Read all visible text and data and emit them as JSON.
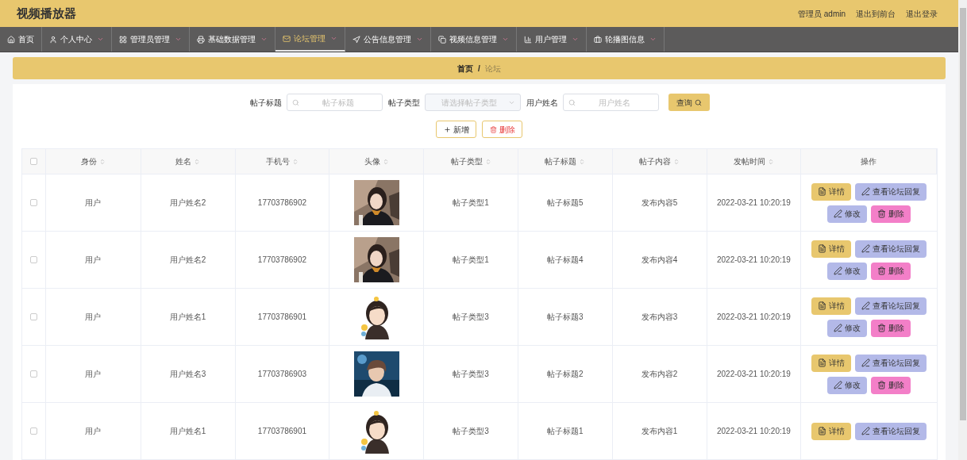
{
  "header": {
    "title": "视频播放器",
    "user": "管理员 admin",
    "links": [
      "退出到前台",
      "退出登录"
    ]
  },
  "nav": [
    {
      "label": "首页",
      "selected": false,
      "dropdown": false
    },
    {
      "label": "个人中心",
      "selected": false,
      "dropdown": true
    },
    {
      "label": "管理员管理",
      "selected": false,
      "dropdown": true
    },
    {
      "label": "基础数据管理",
      "selected": false,
      "dropdown": true
    },
    {
      "label": "论坛管理",
      "selected": true,
      "dropdown": true
    },
    {
      "label": "公告信息管理",
      "selected": false,
      "dropdown": true
    },
    {
      "label": "视频信息管理",
      "selected": false,
      "dropdown": true
    },
    {
      "label": "用户管理",
      "selected": false,
      "dropdown": true
    },
    {
      "label": "轮播图信息",
      "selected": false,
      "dropdown": true
    }
  ],
  "breadcrumb": [
    "首页",
    "/",
    "论坛"
  ],
  "search": {
    "fields": [
      {
        "label": "帖子标题",
        "kind": "text",
        "placeholder": "帖子标题"
      },
      {
        "label": "帖子类型",
        "kind": "select",
        "placeholder": "请选择帖子类型"
      },
      {
        "label": "用户姓名",
        "kind": "text",
        "placeholder": "用户姓名"
      }
    ],
    "button": "查询"
  },
  "actions": [
    {
      "label": "新增",
      "kind": "add"
    },
    {
      "label": "删除",
      "kind": "delete"
    }
  ],
  "table": {
    "select_all_checked": false,
    "columns": [
      {
        "label": "身份",
        "sortable": true
      },
      {
        "label": "姓名",
        "sortable": true
      },
      {
        "label": "手机号",
        "sortable": true
      },
      {
        "label": "头像",
        "sortable": true
      },
      {
        "label": "帖子类型",
        "sortable": true
      },
      {
        "label": "帖子标题",
        "sortable": true
      },
      {
        "label": "帖子内容",
        "sortable": true
      },
      {
        "label": "发帖时间",
        "sortable": true
      },
      {
        "label": "操作",
        "sortable": false
      }
    ],
    "rows": [
      {
        "checked": false,
        "cells": [
          "用户",
          "用户姓名2",
          "17703786902",
          {
            "kind": "picture"
          },
          "帖子类型1",
          "帖子标题5",
          "发布内容5",
          "2022-03-21 10:20:19"
        ],
        "buttons": [
          {
            "label": "详情",
            "kind": "detail"
          },
          {
            "label": "查看论坛回复",
            "kind": "reply"
          },
          {
            "label": "修改",
            "kind": "edit"
          },
          {
            "label": "删除",
            "kind": "delete"
          }
        ]
      },
      {
        "checked": false,
        "cells": [
          "用户",
          "用户姓名2",
          "17703786902",
          {
            "kind": "picture"
          },
          "帖子类型1",
          "帖子标题4",
          "发布内容4",
          "2022-03-21 10:20:19"
        ],
        "buttons": [
          {
            "label": "详情",
            "kind": "detail"
          },
          {
            "label": "查看论坛回复",
            "kind": "reply"
          },
          {
            "label": "修改",
            "kind": "edit"
          },
          {
            "label": "删除",
            "kind": "delete"
          }
        ]
      },
      {
        "checked": false,
        "cells": [
          "用户",
          "用户姓名1",
          "17703786901",
          {
            "kind": "picture"
          },
          "帖子类型3",
          "帖子标题3",
          "发布内容3",
          "2022-03-21 10:20:19"
        ],
        "buttons": [
          {
            "label": "详情",
            "kind": "detail"
          },
          {
            "label": "查看论坛回复",
            "kind": "reply"
          },
          {
            "label": "修改",
            "kind": "edit"
          },
          {
            "label": "删除",
            "kind": "delete"
          }
        ]
      },
      {
        "checked": false,
        "cells": [
          "用户",
          "用户姓名3",
          "17703786903",
          {
            "kind": "picture"
          },
          "帖子类型3",
          "帖子标题2",
          "发布内容2",
          "2022-03-21 10:20:19"
        ],
        "buttons": [
          {
            "label": "详情",
            "kind": "detail"
          },
          {
            "label": "查看论坛回复",
            "kind": "reply"
          },
          {
            "label": "修改",
            "kind": "edit"
          },
          {
            "label": "删除",
            "kind": "delete"
          }
        ]
      },
      {
        "checked": false,
        "cells": [
          "用户",
          "用户姓名1",
          "17703786901",
          {
            "kind": "picture"
          },
          "帖子类型3",
          "帖子标题1",
          "发布内容1",
          "2022-03-21 10:20:19"
        ],
        "buttons": [
          {
            "label": "详情",
            "kind": "detail"
          },
          {
            "label": "查看论坛回复",
            "kind": "reply"
          }
        ]
      }
    ]
  }
}
